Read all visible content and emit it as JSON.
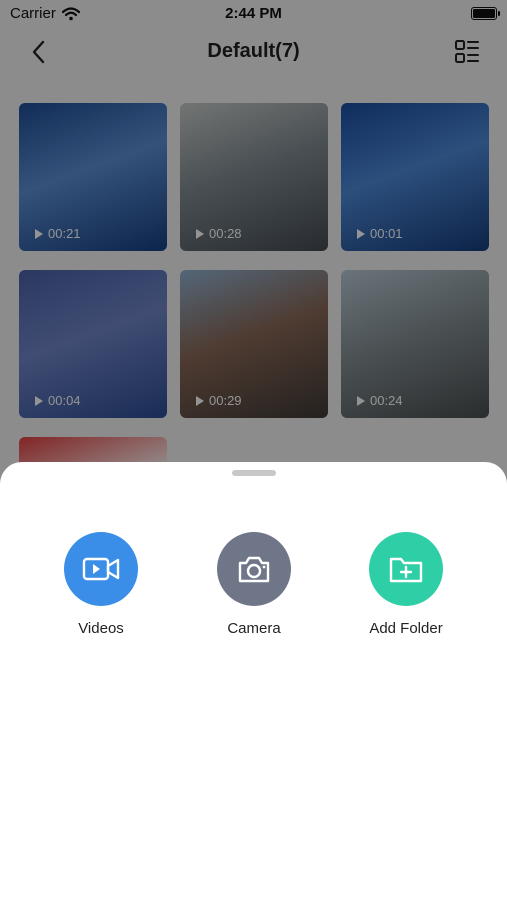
{
  "status": {
    "carrier": "Carrier",
    "time": "2:44 PM",
    "battery_level": 1.0
  },
  "nav": {
    "title": "Default(7)",
    "back_icon": "chevron-left-icon",
    "layout_icon": "list-layout-icon"
  },
  "grid": {
    "items": [
      {
        "duration": "00:21",
        "colors": [
          "#1f4f97",
          "#5a8ed3",
          "#173f82"
        ]
      },
      {
        "duration": "00:28",
        "colors": [
          "#c6c9c8",
          "#7f8a90",
          "#444b52"
        ]
      },
      {
        "duration": "00:01",
        "colors": [
          "#1a4ea2",
          "#4c88d6",
          "#173d7c"
        ]
      },
      {
        "duration": "00:04",
        "colors": [
          "#4a62a7",
          "#6f84c6",
          "#2d4d94"
        ]
      },
      {
        "duration": "00:29",
        "colors": [
          "#8fb0cf",
          "#886756",
          "#3f3a37"
        ]
      },
      {
        "duration": "00:24",
        "colors": [
          "#b7c7d3",
          "#838e92",
          "#4a4e50"
        ]
      },
      {
        "duration": "",
        "colors": [
          "#e0413f",
          "#ffffff",
          "#3b78d6"
        ]
      }
    ]
  },
  "sheet": {
    "actions": [
      {
        "label": "Videos",
        "color": "#3a8ee7",
        "icon": "video-camera-icon"
      },
      {
        "label": "Camera",
        "color": "#6e7687",
        "icon": "camera-icon"
      },
      {
        "label": "Add Folder",
        "color": "#2ecfa6",
        "icon": "folder-add-icon"
      }
    ]
  }
}
